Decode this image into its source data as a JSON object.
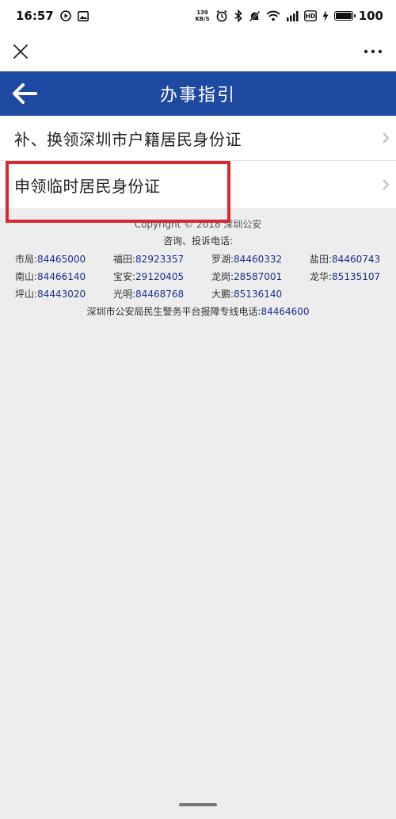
{
  "status_bar": {
    "time": "16:57",
    "net_speed_value": "139",
    "net_speed_unit": "KB/S",
    "battery": "100",
    "icons": [
      "play-circle-icon",
      "image-icon",
      "alarm-icon",
      "bluetooth-icon",
      "mute-icon",
      "wifi-icon",
      "signal-icon",
      "hd-icon",
      "charging-icon",
      "battery-icon"
    ]
  },
  "top_bar": {
    "close_icon": "close-icon",
    "more_icon": "more-icon"
  },
  "header": {
    "title": "办事指引",
    "back_icon": "arrow-left-icon",
    "bg_color": "#1d4aa0"
  },
  "list": {
    "items": [
      {
        "label": "补、换领深圳市户籍居民身份证"
      },
      {
        "label": "申领临时居民身份证"
      }
    ]
  },
  "highlight_color": "#d6282f",
  "footer": {
    "copyright": "Copyright © 2018 深圳公安",
    "consult": "咨询、投诉电话:",
    "phones": [
      {
        "name": "市局:",
        "number": "84465000"
      },
      {
        "name": "福田:",
        "number": "82923357"
      },
      {
        "name": "罗湖:",
        "number": "84460332"
      },
      {
        "name": "盐田:",
        "number": "84460743"
      },
      {
        "name": "南山:",
        "number": "84466140"
      },
      {
        "name": "宝安:",
        "number": "29120405"
      },
      {
        "name": "龙岗:",
        "number": "28587001"
      },
      {
        "name": "龙华:",
        "number": "85135107"
      },
      {
        "name": "坪山:",
        "number": "84443020"
      },
      {
        "name": "光明:",
        "number": "84468768"
      },
      {
        "name": "大鹏:",
        "number": "85136140"
      }
    ],
    "hotline_label": "深圳市公安局民生警务平台报障专线电话:",
    "hotline_number": "84464600"
  }
}
